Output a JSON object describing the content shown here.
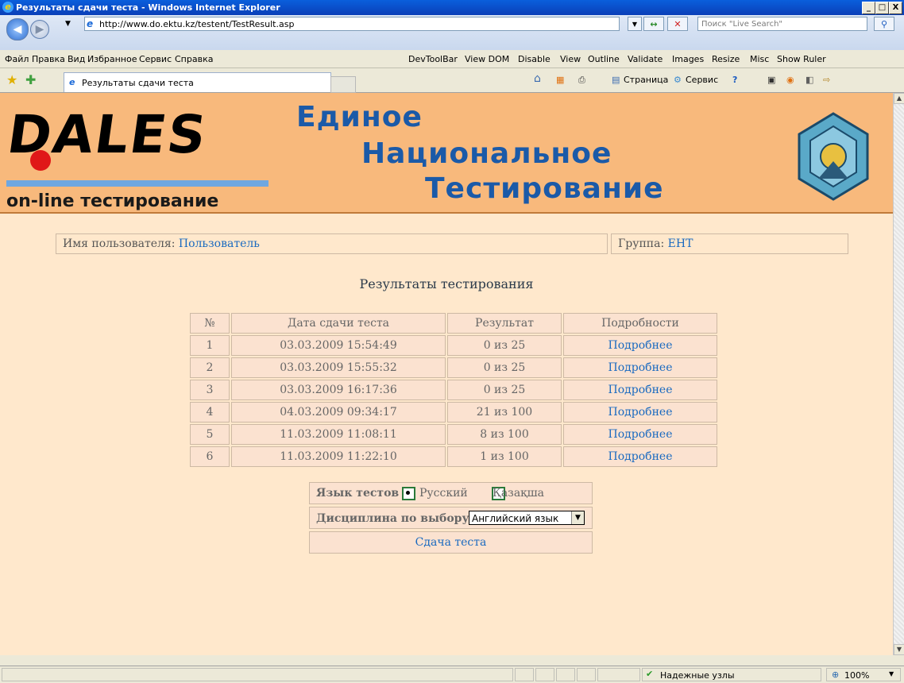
{
  "window": {
    "title": "Результаты сдачи теста - Windows Internet Explorer",
    "min": "_",
    "max": "□",
    "close": "X"
  },
  "address": {
    "url": "http://www.do.ektu.kz/testent/TestResult.asp",
    "search_placeholder": "Поиск \"Live Search\""
  },
  "menu": {
    "items": [
      "Файл",
      "Правка",
      "Вид",
      "Избранное",
      "Сервис",
      "Справка"
    ],
    "devtool": [
      "DevToolBar",
      "View DOM",
      "Disable",
      "View",
      "Outline",
      "Validate",
      "Images",
      "Resize",
      "Misc",
      "Show Ruler"
    ]
  },
  "tab": {
    "label": "Результаты сдачи теста"
  },
  "toolbar": {
    "page": "Страница",
    "service": "Сервис"
  },
  "banner": {
    "logo": "DALES",
    "subtitle": "on-line тестирование",
    "line1": "Единое",
    "line2": "Национальное",
    "line3": "Тестирование"
  },
  "user": {
    "label": "Имя пользователя:",
    "name": "Пользователь",
    "group_label": "Группа:",
    "group": "ЕНТ"
  },
  "results": {
    "title": "Результаты тестирования",
    "headers": [
      "№",
      "Дата сдачи теста",
      "Результат",
      "Подробности"
    ],
    "rows": [
      {
        "n": "1",
        "date": "03.03.2009 15:54:49",
        "result": "0 из 25",
        "link": "Подробнее"
      },
      {
        "n": "2",
        "date": "03.03.2009 15:55:32",
        "result": "0 из 25",
        "link": "Подробнее"
      },
      {
        "n": "3",
        "date": "03.03.2009 16:17:36",
        "result": "0 из 25",
        "link": "Подробнее"
      },
      {
        "n": "4",
        "date": "04.03.2009 09:34:17",
        "result": "21 из 100",
        "link": "Подробнее"
      },
      {
        "n": "5",
        "date": "11.03.2009 11:08:11",
        "result": "8 из 100",
        "link": "Подробнее"
      },
      {
        "n": "6",
        "date": "11.03.2009 11:22:10",
        "result": "1 из 100",
        "link": "Подробнее"
      }
    ]
  },
  "options": {
    "lang_label": "Язык тестов",
    "lang_ru": "Русский",
    "lang_kz": "Қазақша",
    "selected_lang": "Русский",
    "discipline_label": "Дисциплина по выбору",
    "discipline_value": "Английский язык",
    "submit": "Сдача теста"
  },
  "status": {
    "trusted": "Надежные узлы",
    "zoom": "100%"
  }
}
